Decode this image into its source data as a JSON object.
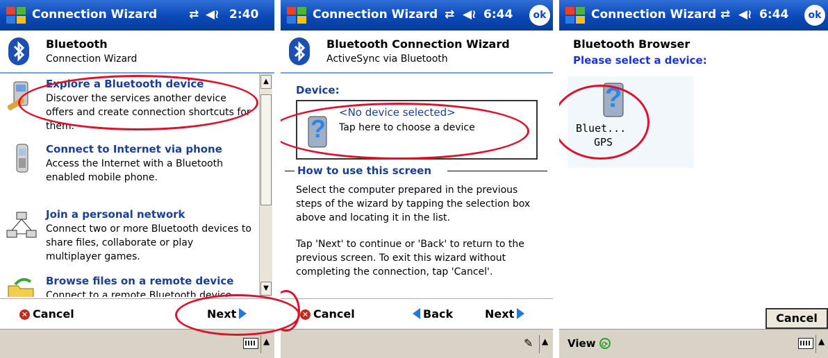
{
  "screen1": {
    "title": "Connection Wizard",
    "time": "2:40",
    "header_title": "Bluetooth",
    "header_subtitle": "Connection Wizard",
    "items": [
      {
        "title": "Explore a Bluetooth device",
        "desc": "Discover the services another device offers and create connection shortcuts for them."
      },
      {
        "title": "Connect to Internet via phone",
        "desc": "Access the Internet with a Bluetooth enabled mobile phone."
      },
      {
        "title": "Join a personal network",
        "desc": "Connect two or more Bluetooth devices to share files, collaborate or play multiplayer games."
      },
      {
        "title": "Browse files on a remote device",
        "desc": "Connect to a remote Bluetooth device"
      }
    ],
    "cancel": "Cancel",
    "next": "Next"
  },
  "screen2": {
    "title": "Connection Wizard",
    "time": "6:44",
    "ok": "ok",
    "header_title": "Bluetooth Connection Wizard",
    "header_subtitle": "ActiveSync via Bluetooth",
    "device_label": "Device:",
    "device_value": "<No device selected>",
    "device_hint": "Tap here to choose a device",
    "howto_title": "How to use this screen",
    "para1": "Select the computer prepared in the previous steps of the wizard by tapping the selection box above and locating it in the list.",
    "para2": "Tap 'Next' to continue or 'Back' to return to the previous screen. To exit this wizard without completing the connection, tap 'Cancel'.",
    "cancel": "Cancel",
    "back": "Back",
    "next": "Next"
  },
  "screen3": {
    "title": "Connection Wizard",
    "time": "6:44",
    "ok": "ok",
    "browser_title": "Bluetooth Browser",
    "prompt": "Please select a device:",
    "device_line1": "Bluet...",
    "device_line2": "GPS",
    "cancel": "Cancel",
    "view": "View"
  },
  "colors": {
    "titlebar": "#0a49b8",
    "link": "#1b3f93",
    "highlight_ring": "#e0102a"
  }
}
